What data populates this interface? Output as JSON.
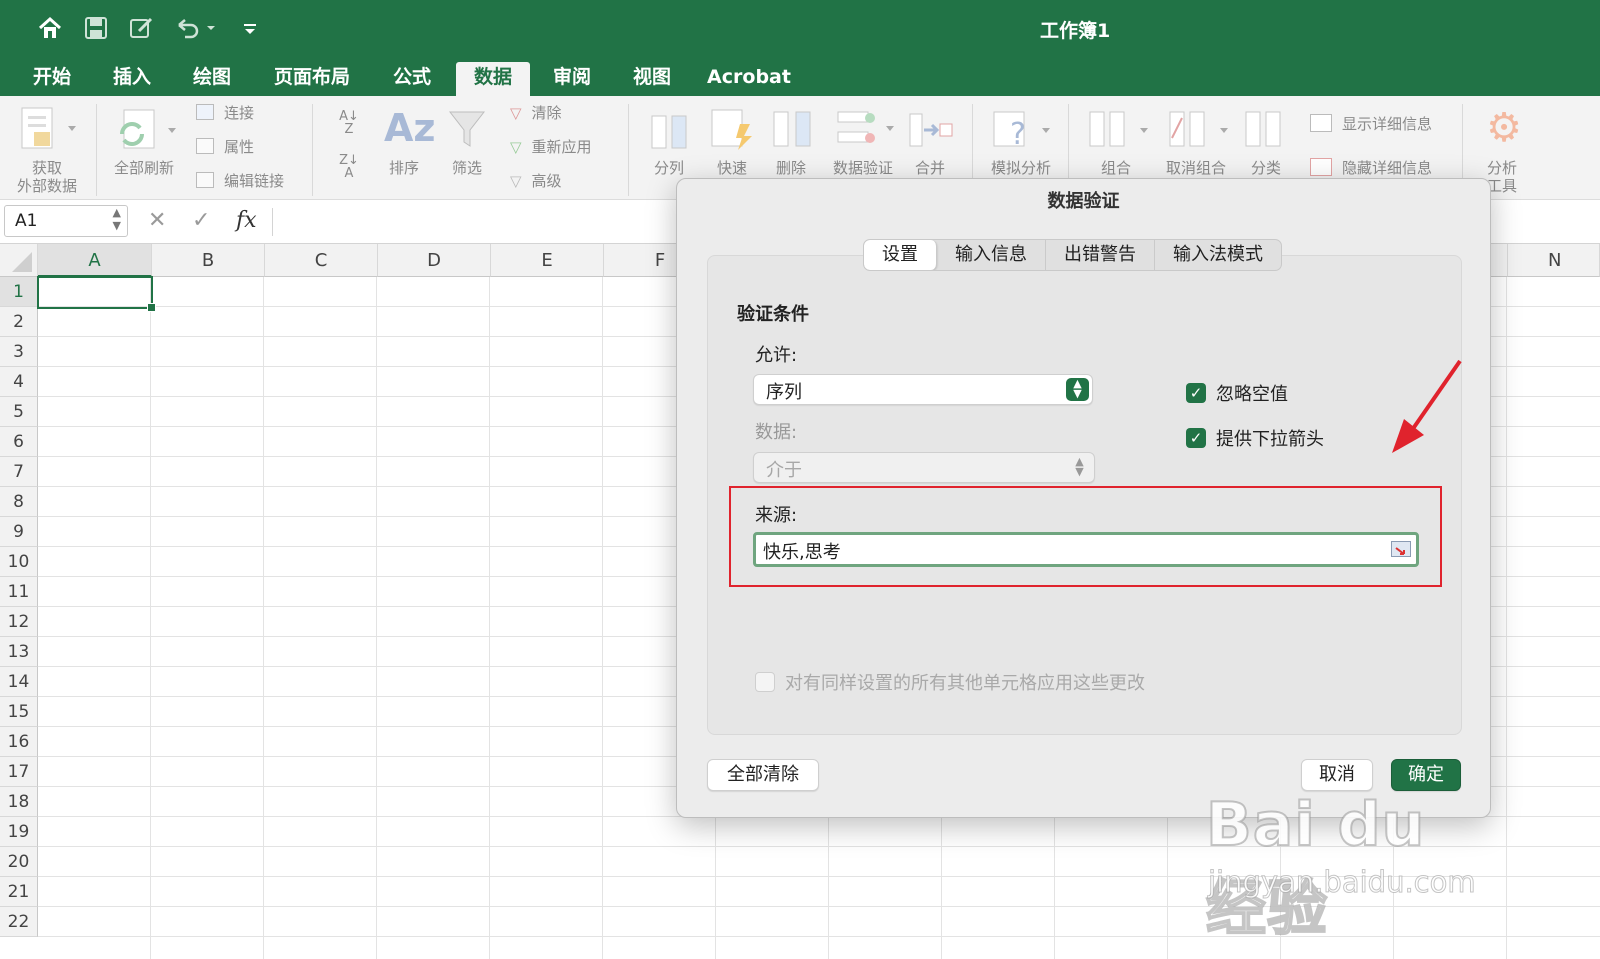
{
  "window": {
    "title": "工作簿1"
  },
  "quick_access": {
    "icons": [
      "home-icon",
      "save-icon",
      "edit-icon",
      "undo-icon",
      "customize-icon"
    ]
  },
  "menu": {
    "tabs": [
      "开始",
      "插入",
      "绘图",
      "页面布局",
      "公式",
      "数据",
      "审阅",
      "视图",
      "Acrobat"
    ],
    "active": "数据"
  },
  "ribbon": {
    "get_external_data_line1": "获取",
    "get_external_data_line2": "外部数据",
    "refresh_all": "全部刷新",
    "connections": "连接",
    "properties": "属性",
    "edit_links": "编辑链接",
    "sort": "排序",
    "filter": "筛选",
    "clear": "清除",
    "reapply": "重新应用",
    "advanced": "高级",
    "text_to_columns": "分列",
    "flash_fill": "快速",
    "remove_duplicates": "删除",
    "data_validation": "数据验证",
    "consolidate": "合并",
    "what_if": "模拟分析",
    "group": "组合",
    "ungroup": "取消组合",
    "subtotal": "分类",
    "show_detail": "显示详细信息",
    "hide_detail": "隐藏详细信息",
    "analysis_tools_line1": "分析",
    "analysis_tools_line2": "工具"
  },
  "formula_bar": {
    "name_box": "A1",
    "fx": "fx",
    "cancel": "✕",
    "enter": "✓"
  },
  "grid": {
    "columns": [
      "A",
      "B",
      "C",
      "D",
      "E",
      "F",
      "N"
    ],
    "rows": [
      "1",
      "2",
      "3",
      "4",
      "5",
      "6",
      "7",
      "8",
      "9",
      "10",
      "11",
      "12",
      "13",
      "14",
      "15",
      "16",
      "17",
      "18",
      "19",
      "20",
      "21",
      "22"
    ],
    "active_cell": "A1"
  },
  "dialog": {
    "title": "数据验证",
    "tabs": [
      "设置",
      "输入信息",
      "出错警告",
      "输入法模式"
    ],
    "active_tab": "设置",
    "section_title": "验证条件",
    "allow_label": "允许:",
    "allow_value": "序列",
    "data_label": "数据:",
    "data_value": "介于",
    "ignore_blank_label": "忽略空值",
    "ignore_blank_checked": true,
    "in_cell_dropdown_label": "提供下拉箭头",
    "in_cell_dropdown_checked": true,
    "source_label": "来源:",
    "source_value": "快乐,思考",
    "apply_all_label": "对有同样设置的所有其他单元格应用这些更改",
    "apply_all_checked": false,
    "clear_all_button": "全部清除",
    "cancel_button": "取消",
    "ok_button": "确定"
  },
  "annotation": {
    "arrow_color": "#e0232d",
    "highlight_color": "#e0232d"
  },
  "watermark": {
    "brand": "Bai du 经验",
    "url": "jingyan.baidu.com"
  },
  "colors": {
    "accent": "#217346"
  }
}
